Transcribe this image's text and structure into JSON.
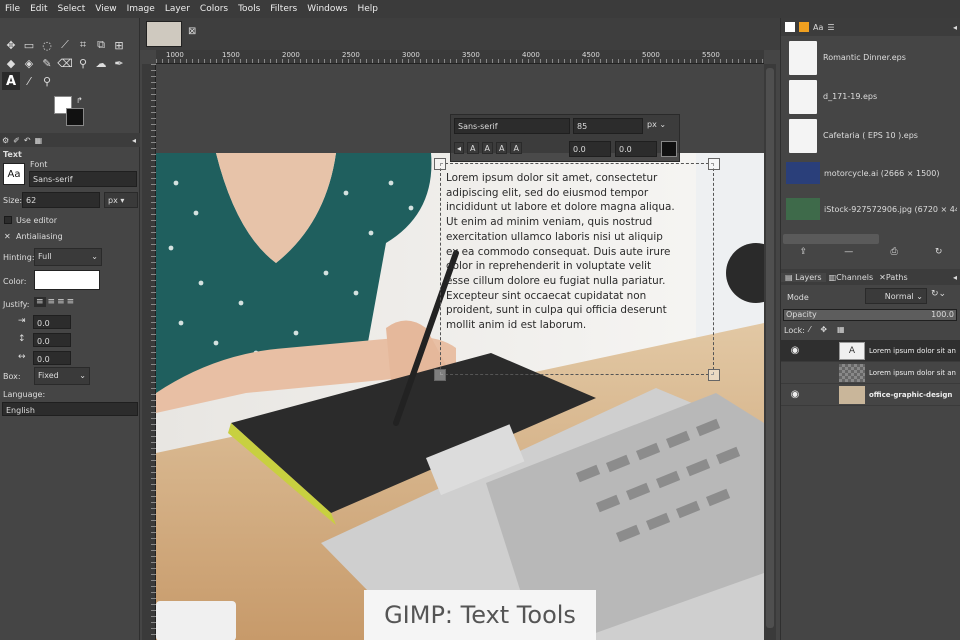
{
  "menu": [
    "File",
    "Edit",
    "Select",
    "View",
    "Image",
    "Layer",
    "Colors",
    "Tools",
    "Filters",
    "Windows",
    "Help"
  ],
  "toolbox": {
    "tool_options_title": "Text",
    "font_label": "Font",
    "font_value": "Sans-serif",
    "size_label": "Size:",
    "size_value": "62",
    "size_unit": "px",
    "use_editor": "Use editor",
    "antialiasing": "Antialiasing",
    "hinting_label": "Hinting:",
    "hinting_value": "Full",
    "color_label": "Color:",
    "justify_label": "Justify:",
    "indent_value": "0.0",
    "line_spacing_value": "0.0",
    "letter_spacing_value": "0.0",
    "box_label": "Box:",
    "box_value": "Fixed",
    "language_label": "Language:",
    "language_value": "English",
    "font_preview": "Aa"
  },
  "ruler": {
    "marks": [
      "1000",
      "1500",
      "2000",
      "2500",
      "3000",
      "3500",
      "4000",
      "4500",
      "5000",
      "5500"
    ]
  },
  "text_toolbar": {
    "font": "Sans-serif",
    "size": "85",
    "unit": "px",
    "baseline": "0.0",
    "kerning": "0.0"
  },
  "text_lines": [
    "Lorem ipsum dolor sit amet, consectetur",
    "adipiscing elit, sed do eiusmod tempor",
    "incididunt ut labore et dolore magna aliqua.",
    "Ut enim ad minim veniam, quis nostrud",
    "exercitation ullamco laboris nisi ut aliquip",
    "ex ea commodo consequat. Duis aute irure",
    "dolor in reprehenderit in voluptate velit",
    "esse cillum dolore eu fugiat nulla pariatur.",
    "Excepteur sint occaecat cupidatat non",
    "proident, sunt in culpa qui officia deserunt",
    "mollit anim id est laborum."
  ],
  "images": [
    {
      "name": "Romantic Dinner.eps",
      "kind": "doc"
    },
    {
      "name": "d_171-19.eps",
      "kind": "doc"
    },
    {
      "name": "Cafetaria ( EPS 10 ).eps",
      "kind": "doc"
    },
    {
      "name": "motorcycle.ai (2666 × 1500)",
      "kind": "photo-blue"
    },
    {
      "name": "iStock-927572906.jpg (6720 × 448",
      "kind": "photo-green"
    }
  ],
  "layers_panel": {
    "tabs": [
      "Layers",
      "Channels",
      "Paths"
    ],
    "mode_label": "Mode",
    "mode_value": "Normal",
    "opacity_label": "Opacity",
    "opacity_value": "100.0",
    "lock_label": "Lock:",
    "layers": [
      {
        "name": "Lorem ipsum dolor sit an",
        "visible": true,
        "bold": false
      },
      {
        "name": "Lorem ipsum dolor sit an",
        "visible": false,
        "bold": false
      },
      {
        "name": "office-graphic-design",
        "visible": true,
        "bold": true
      }
    ]
  },
  "caption": "GIMP: Text Tools"
}
